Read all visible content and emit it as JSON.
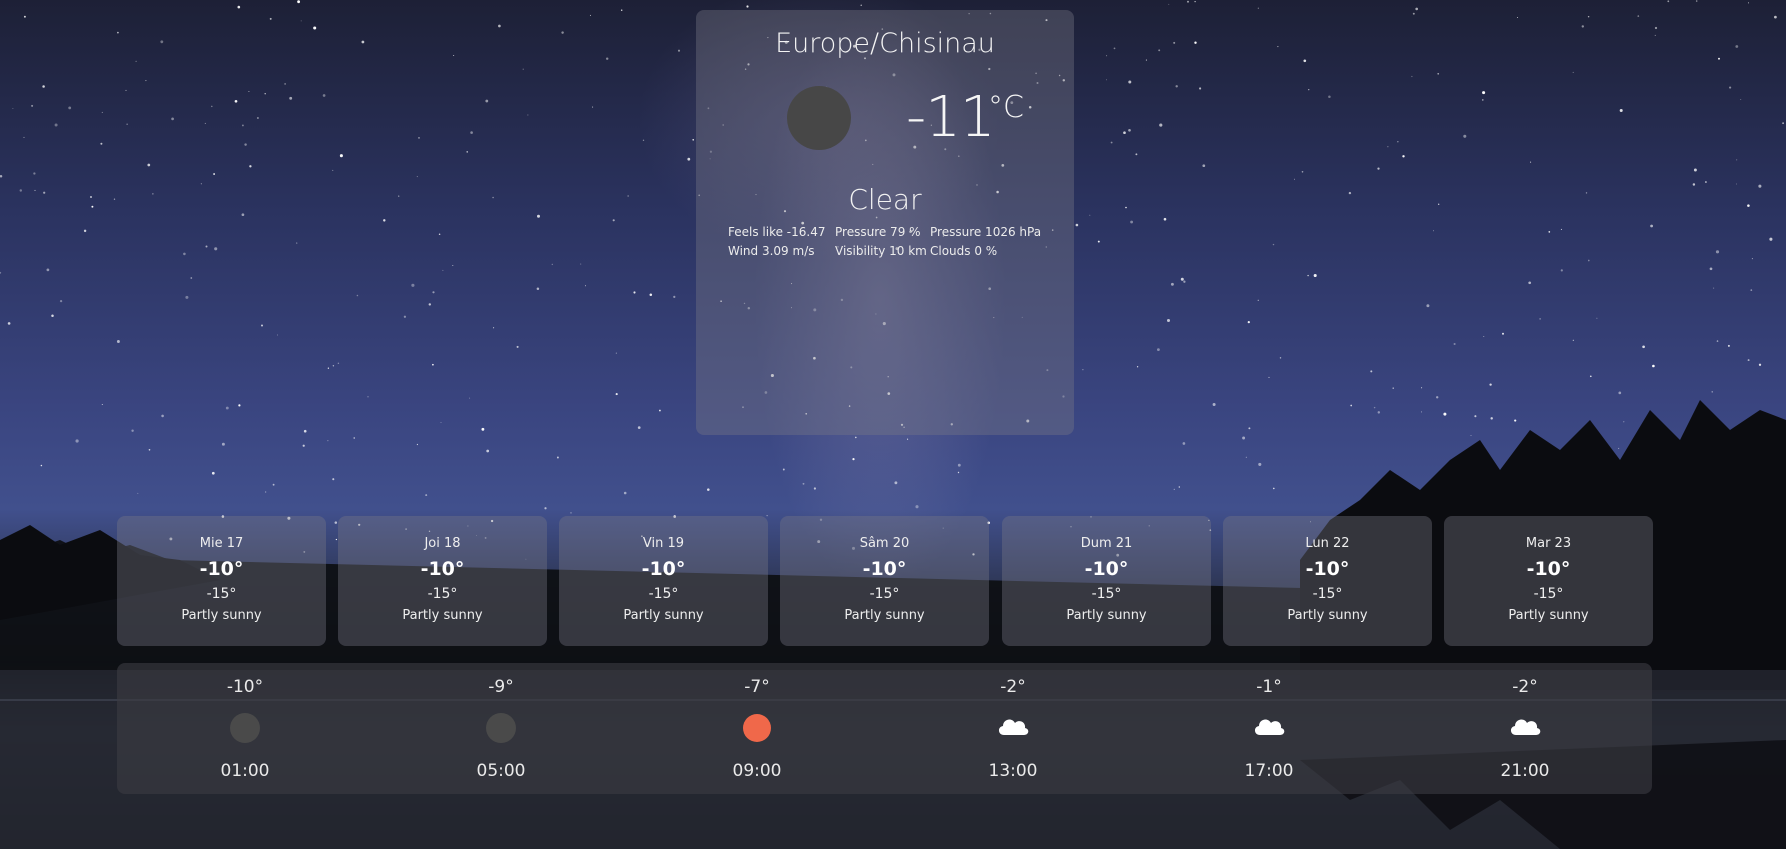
{
  "current": {
    "city": "Europe/Chisinau",
    "icon": "clear-night-icon",
    "temperature": "-11",
    "unit": "°C",
    "condition": "Clear",
    "details": [
      "Feels like -16.47",
      "Pressure 79 %",
      "Pressure 1026 hPa",
      "Wind 3.09 m/s",
      "Visibility 10 km",
      "Clouds 0 %"
    ]
  },
  "daily": [
    {
      "day": "Mie 17",
      "high": "-10°",
      "low": "-15°",
      "description": "Partly sunny"
    },
    {
      "day": "Joi 18",
      "high": "-10°",
      "low": "-15°",
      "description": "Partly sunny"
    },
    {
      "day": "Vin 19",
      "high": "-10°",
      "low": "-15°",
      "description": "Partly sunny"
    },
    {
      "day": "Sâm 20",
      "high": "-10°",
      "low": "-15°",
      "description": "Partly sunny"
    },
    {
      "day": "Dum 21",
      "high": "-10°",
      "low": "-15°",
      "description": "Partly sunny"
    },
    {
      "day": "Lun 22",
      "high": "-10°",
      "low": "-15°",
      "description": "Partly sunny"
    },
    {
      "day": "Mar 23",
      "high": "-10°",
      "low": "-15°",
      "description": "Partly sunny"
    }
  ],
  "hourly": [
    {
      "temp": "-10°",
      "time": "01:00",
      "icon": "clear-night-icon"
    },
    {
      "temp": "-9°",
      "time": "05:00",
      "icon": "clear-night-icon"
    },
    {
      "temp": "-7°",
      "time": "09:00",
      "icon": "sun-icon"
    },
    {
      "temp": "-2°",
      "time": "13:00",
      "icon": "cloud-icon"
    },
    {
      "temp": "-1°",
      "time": "17:00",
      "icon": "cloud-icon"
    },
    {
      "temp": "-2°",
      "time": "21:00",
      "icon": "cloud-icon"
    }
  ],
  "colors": {
    "sun": "#f0684a",
    "night-icon": "#4a4a4a"
  }
}
